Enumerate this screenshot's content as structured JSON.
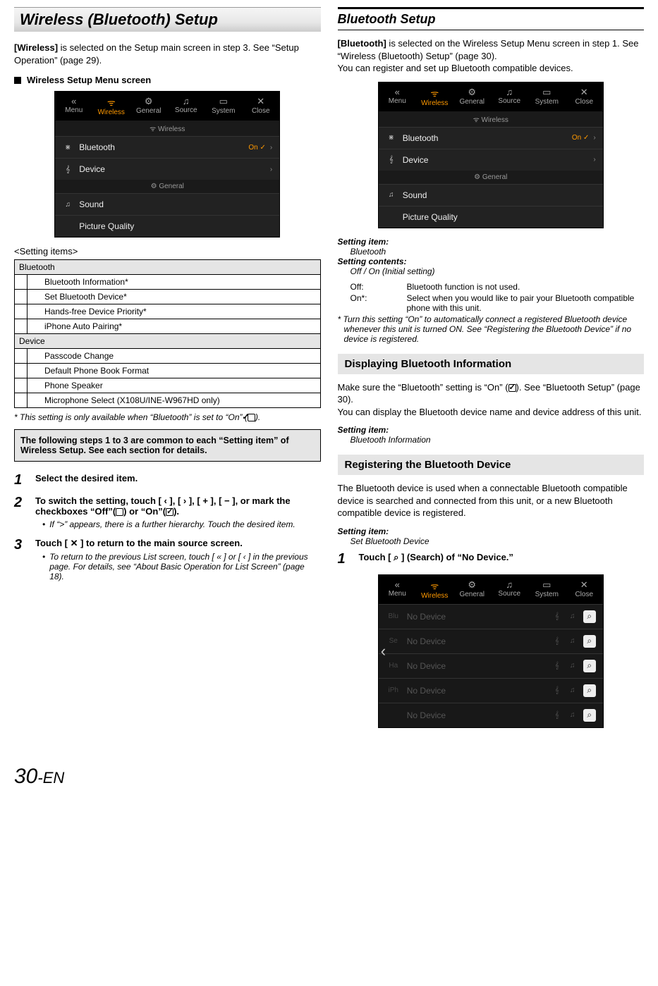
{
  "left": {
    "title": "Wireless (Bluetooth) Setup",
    "intro_a": "[Wireless]",
    "intro_b": " is selected on the Setup main screen in step 3. See “Setup Operation” (page 29).",
    "subhead": "Wireless Setup Menu screen",
    "ss": {
      "tabs": [
        {
          "icon": "«",
          "label": "Menu"
        },
        {
          "icon": "ᯤ",
          "label": "Wireless",
          "active": true
        },
        {
          "icon": "⚙",
          "label": "General"
        },
        {
          "icon": "♫",
          "label": "Source"
        },
        {
          "icon": "▭",
          "label": "System"
        },
        {
          "icon": "✕",
          "label": "Close"
        }
      ],
      "bar": "ᯤ Wireless",
      "rows": [
        {
          "icon": "⋇",
          "label": "Bluetooth",
          "val": "On ✓",
          "chev": "›"
        },
        {
          "icon": "𝄞",
          "label": "Device",
          "chev": "›"
        }
      ],
      "bar2": "⚙ General",
      "rows2": [
        {
          "icon": "♫",
          "label": "Sound",
          "chev": ""
        },
        {
          "icon": "",
          "label": "Picture Quality",
          "chev": ""
        }
      ]
    },
    "setting_items_label": "<Setting items>",
    "table": {
      "g1": "Bluetooth",
      "g1_items": [
        "Bluetooth Information*",
        "Set Bluetooth Device*",
        "Hands-free Device Priority*",
        "iPhone Auto Pairing*"
      ],
      "g2": "Device",
      "g2_items": [
        "Passcode Change",
        "Default Phone Book Format",
        "Phone Speaker",
        "Microphone Select (X108U/INE-W967HD only)"
      ]
    },
    "footnote": "* This setting is only available when “Bluetooth” is set to “On” (",
    "footnote_end": ").",
    "callout": "The following steps 1 to 3 are common to each “Setting item” of Wireless Setup. See each section for details.",
    "steps": [
      {
        "n": "1",
        "main": "Select the desired item."
      },
      {
        "n": "2",
        "main_a": "To switch the setting, touch [ ‹ ], [ › ], [ + ], [ − ], or mark the checkboxes “Off”(",
        "main_b": ") or “On”(",
        "main_c": ").",
        "note_bullet": "•",
        "note": "If “>” appears, there is a further hierarchy. Touch the desired item."
      },
      {
        "n": "3",
        "main": "Touch [ ✕ ] to return to the main source screen.",
        "note_bullet": "•",
        "note": "To return to the previous List screen, touch [ « ] or [ ‹ ] in the previous page. For details, see “About Basic Operation for List Screen” (page 18)."
      }
    ]
  },
  "right": {
    "title": "Bluetooth Setup",
    "intro_a": "[Bluetooth]",
    "intro_b": " is selected on the Wireless Setup Menu screen in step 1. See “Wireless (Bluetooth) Setup” (page 30).",
    "intro_c": "You can register and set up Bluetooth compatible devices.",
    "si1": {
      "label": "Setting item:",
      "val": "Bluetooth"
    },
    "sc1": {
      "label": "Setting contents:",
      "val": "Off / On (Initial setting)"
    },
    "defs": [
      {
        "k": "Off:",
        "v": "Bluetooth function is not used."
      },
      {
        "k": "On*:",
        "v": "Select when you would like to pair your Bluetooth compatible phone with this unit."
      }
    ],
    "footnote2": "* Turn this setting “On” to automatically connect a registered Bluetooth device whenever this unit is turned ON. See “Registering the Bluetooth Device” if no device is registered.",
    "sub1": "Displaying Bluetooth Information",
    "sub1_body_a": "Make sure the “Bluetooth” setting is “On” (",
    "sub1_body_b": "). See “Bluetooth Setup” (page 30).",
    "sub1_body_c": "You can display the Bluetooth device name and device address of this unit.",
    "si2": {
      "label": "Setting item:",
      "val": "Bluetooth Information"
    },
    "sub2": "Registering the Bluetooth Device",
    "sub2_body": "The Bluetooth device is used when a connectable Bluetooth compatible device is searched and connected from this unit, or a new Bluetooth compatible device is registered.",
    "si3": {
      "label": "Setting item:",
      "val": "Set Bluetooth Device"
    },
    "step1": {
      "n": "1",
      "main_a": "Touch [ ",
      "main_b": " ] (Search) of “No Device.”"
    },
    "ss2": {
      "rows": [
        "No Device",
        "No Device",
        "No Device",
        "No Device",
        "No Device"
      ],
      "side_labels": [
        "Blu",
        "Se",
        "Ha",
        "iPh",
        ""
      ]
    },
    "magnifier": "⌕"
  },
  "page_num_big": "30",
  "page_num_suffix": "-EN"
}
